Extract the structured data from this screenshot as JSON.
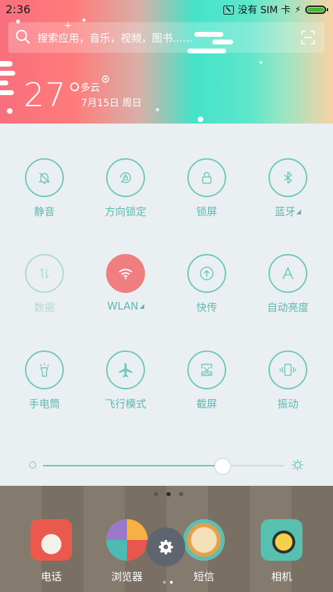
{
  "status_bar": {
    "time": "2:36",
    "carrier": "没有 SIM 卡"
  },
  "search": {
    "placeholder": "搜索应用，音乐，视频，图书......"
  },
  "weather": {
    "temp": "27°",
    "condition": "多云",
    "date": "7月15日 周日"
  },
  "toggles": [
    {
      "label": "静音",
      "icon": "bell-off-icon",
      "state": "off"
    },
    {
      "label": "方向锁定",
      "icon": "rotation-lock-icon",
      "state": "off"
    },
    {
      "label": "锁屏",
      "icon": "lock-icon",
      "state": "off"
    },
    {
      "label": "蓝牙",
      "icon": "bluetooth-icon",
      "state": "off"
    },
    {
      "label": "数据",
      "icon": "data-arrows-icon",
      "state": "disabled"
    },
    {
      "label": "WLAN",
      "icon": "wifi-icon",
      "state": "on"
    },
    {
      "label": "快传",
      "icon": "upload-icon",
      "state": "off"
    },
    {
      "label": "自动亮度",
      "icon": "auto-brightness-icon",
      "state": "off"
    },
    {
      "label": "手电筒",
      "icon": "flashlight-icon",
      "state": "off"
    },
    {
      "label": "飞行模式",
      "icon": "airplane-icon",
      "state": "off"
    },
    {
      "label": "截屏",
      "icon": "screenshot-scissors-icon",
      "state": "off"
    },
    {
      "label": "振动",
      "icon": "vibrate-icon",
      "state": "off"
    }
  ],
  "brightness": {
    "level": 0.74
  },
  "dock": [
    {
      "label": "电话",
      "icon": "phone-icon"
    },
    {
      "label": "浏览器",
      "icon": "browser-icon"
    },
    {
      "label": "短信",
      "icon": "messages-icon"
    },
    {
      "label": "相机",
      "icon": "camera-icon"
    }
  ],
  "colors": {
    "accent": "#5fb8af",
    "active": "#f17e7e"
  }
}
